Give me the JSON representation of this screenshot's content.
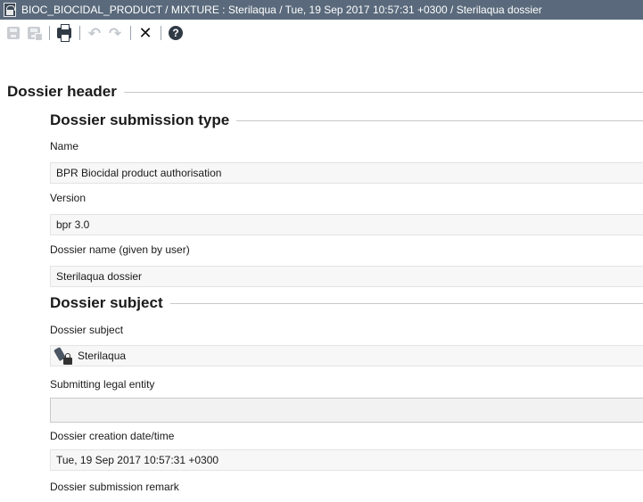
{
  "window": {
    "title": "BIOC_BIOCIDAL_PRODUCT / MIXTURE : Sterilaqua / Tue, 19 Sep 2017 10:57:31 +0300 / Sterilaqua dossier"
  },
  "toolbar": {
    "icons": [
      "save-icon",
      "save-all-icon",
      "print-icon",
      "undo-icon",
      "redo-icon",
      "close-icon",
      "help-icon"
    ],
    "close_glyph": "✕",
    "help_glyph": "?"
  },
  "sections": {
    "header_title": "Dossier header",
    "submission_type_title": "Dossier submission type",
    "subject_title": "Dossier subject"
  },
  "fields": {
    "name": {
      "label": "Name",
      "value": "BPR Biocidal product authorisation"
    },
    "version": {
      "label": "Version",
      "value": "bpr 3.0"
    },
    "dossier_name": {
      "label": "Dossier name (given by user)",
      "value": "Sterilaqua dossier"
    },
    "dossier_subject": {
      "label": "Dossier subject",
      "value": "Sterilaqua"
    },
    "submitting_legal_entity": {
      "label": "Submitting legal entity",
      "value": ""
    },
    "creation_date": {
      "label": "Dossier creation date/time",
      "value": "Tue, 19 Sep 2017 10:57:31 +0300"
    },
    "submission_remark": {
      "label": "Dossier submission remark"
    }
  }
}
